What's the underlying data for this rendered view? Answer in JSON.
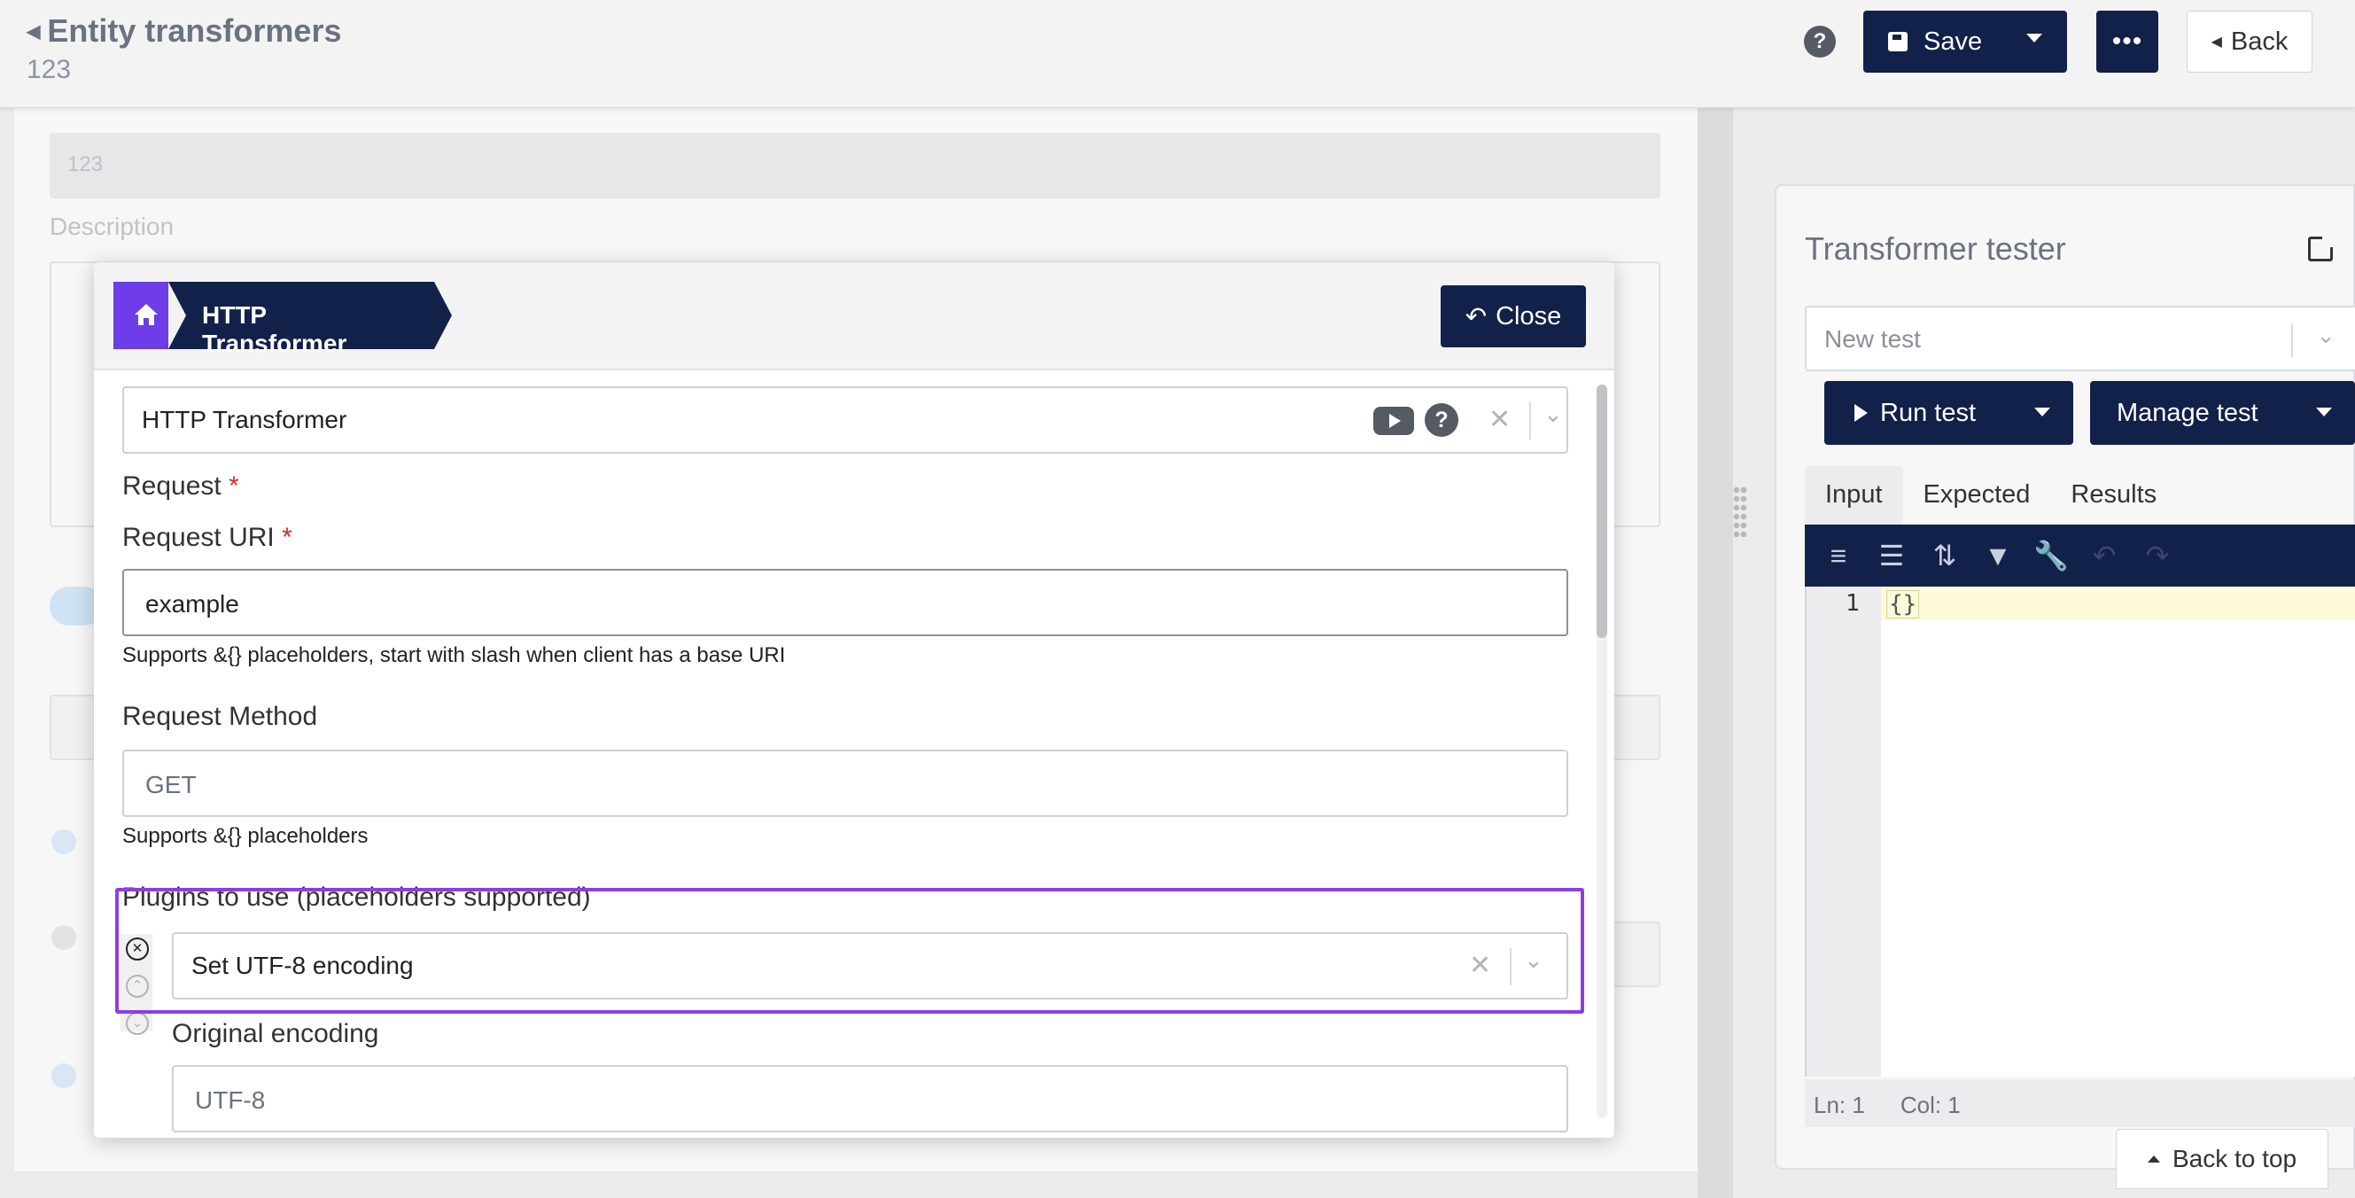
{
  "header": {
    "title": "Entity transformers",
    "subtitle": "123",
    "save_label": "Save",
    "more_label": "•••",
    "back_label": "Back",
    "help_label": "?"
  },
  "background_form": {
    "name_value": "123",
    "description_label": "Description"
  },
  "modal": {
    "breadcrumb": "HTTP Transformer",
    "close_label": "Close",
    "transformer_type": "HTTP Transformer",
    "help_label": "?",
    "request_label": "Request",
    "request_uri_label": "Request URI",
    "required_mark": "*",
    "request_uri_value": "example",
    "request_uri_hint": "Supports &{} placeholders, start with slash when client has a base URI",
    "request_method_label": "Request Method",
    "request_method_placeholder": "GET",
    "request_method_hint": "Supports &{} placeholders",
    "plugins_label": "Plugins to use (placeholders supported)",
    "plugin_selected": "Set UTF-8 encoding",
    "original_encoding_label": "Original encoding",
    "original_encoding_placeholder": "UTF-8"
  },
  "tester": {
    "title": "Transformer tester",
    "test_select_placeholder": "New test",
    "run_label": "Run test",
    "manage_label": "Manage test",
    "tabs": [
      "Input",
      "Expected",
      "Results"
    ],
    "active_tab": "Input",
    "line_number": "1",
    "code": "{}",
    "status_ln": "Ln: 1",
    "status_col": "Col: 1"
  },
  "back_to_top_label": "Back to top",
  "colors": {
    "navy": "#12214a",
    "purple": "#6d3de7",
    "highlight": "#8b3fe0"
  }
}
